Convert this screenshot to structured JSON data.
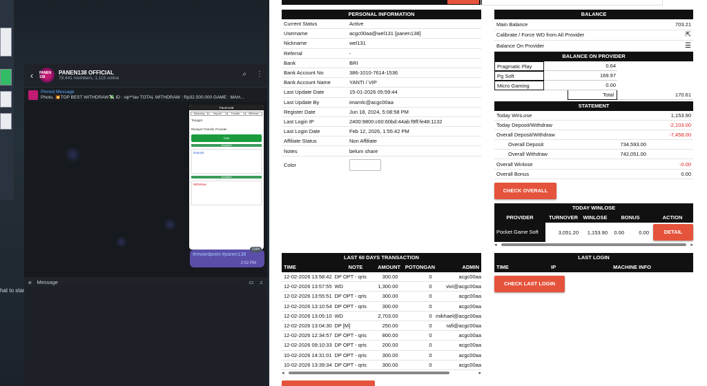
{
  "telegram": {
    "channel_name": "PANEN138 OFFICIAL",
    "channel_sub": "78,441 members, 1,115 online",
    "avatar_text": "PANEN 138",
    "pinned_label": "Pinned Message",
    "pinned_text": "Photo, 💥TOP BEST WITHDRAW💸 ID : vip**iav TOTAL WITHDRAW : Rp32.500.000 GAME : MAH...",
    "reward_text": "#rewardpoint #panen138",
    "reward_time": "2:02 PM",
    "reward_badge": "2184",
    "input_placeholder": "Message",
    "side_text": "hat to start messaging",
    "phone": {
      "logo": "Panen138",
      "tabs": [
        "Balancing",
        "Deposit",
        "Transfer",
        "Withdraw"
      ],
      "label_date": "Tanggal",
      "label_provider": "Riwayat Transfer Provider",
      "btn": "Cari",
      "accepted": "Accepted",
      "deposit": "Deposit",
      "withdraw": "Withdraw"
    }
  },
  "personal": {
    "title": "PERSONAL INFORMATION",
    "rows": [
      {
        "k": "Current Status",
        "v": "Active"
      },
      {
        "k": "Username",
        "v": "acgc00aa@wel131  [panen138]"
      },
      {
        "k": "Nickname",
        "v": "wel131"
      },
      {
        "k": "Referral",
        "v": "-"
      },
      {
        "k": "Bank",
        "v": "BRI"
      },
      {
        "k": "Bank Account No",
        "v": "386-1010-7614-1536"
      },
      {
        "k": "Bank Account Name",
        "v": "YANTI / VIP"
      },
      {
        "k": "Last Update Date",
        "v": "15-01-2026 05:59:44"
      },
      {
        "k": "Last Update By",
        "v": "imamlc@acgc00aa"
      },
      {
        "k": "Register Date",
        "v": "Jun 18, 2024, 5:08:58 PM"
      },
      {
        "k": "Last Login IP",
        "v": "2400:9800:c60:60bd:44ab:f9ff:fe48:1132"
      },
      {
        "k": "Last Login Date",
        "v": "Feb 12, 2026, 1:55:42 PM"
      },
      {
        "k": "Affiliate Status",
        "v": "Non Affiliate"
      },
      {
        "k": "Notes",
        "v": "belum share"
      }
    ],
    "color_label": "Color"
  },
  "balance": {
    "title": "BALANCE",
    "main_label": "Main Balance",
    "main_value": "703.21",
    "calibrate_label": "Calibrate / Force WD from All Provider",
    "onprovider_label": "Balance On Provider",
    "provider_title": "BALANCE ON PROVIDER",
    "providers": [
      {
        "name": "Pragmatic Play",
        "value": "0.64"
      },
      {
        "name": "Pg Soft",
        "value": "169.97"
      },
      {
        "name": "Micro Gaming",
        "value": "0.00"
      }
    ],
    "total_label": "Total",
    "total_value": "170.61"
  },
  "statement": {
    "title": "STATEMENT",
    "today_winlose_label": "Today WinLose",
    "today_winlose": "1,153.90",
    "today_dw_label": "Today Deposit/Withdraw",
    "today_dw": "-2,103.00",
    "overall_dw_label": "Overall Deposit/Withdraw",
    "overall_dw": "-7,458.00",
    "overall_deposit_label": "Overall Deposit",
    "overall_deposit": "734,593.00",
    "overall_withdraw_label": "Overall Withdraw",
    "overall_withdraw": "742,051.00",
    "overall_winlose_label": "Overall Winlose",
    "overall_winlose": "-0.00",
    "overall_bonus_label": "Overall Bonus",
    "overall_bonus": "0.00",
    "check_overall": "CHECK OVERALL"
  },
  "today_winlose": {
    "title": "TODAY WINLOSE",
    "cols": [
      "PROVIDER",
      "TURNOVER",
      "WINLOSE",
      "BONUS",
      "ACTION"
    ],
    "row": {
      "provider": "Pocket Game Soft",
      "turnover": "3,051.20",
      "winlose": "1,153.90",
      "bonus1": "0.00",
      "bonus2": "0.00",
      "action": "DETAIL"
    }
  },
  "last_login": {
    "title": "LAST LOGIN",
    "cols": [
      "TIME",
      "IP",
      "MACHINE INFO"
    ],
    "button": "CHECK LAST LOGIN"
  },
  "last60": {
    "title": "LAST 60 DAYS TRANSACTION",
    "cols": [
      "TIME",
      "NOTE",
      "AMOUNT",
      "POTONGAN",
      "ADMIN"
    ],
    "rows": [
      [
        "12-02-2026 13:58:42",
        "DP OPT - qris",
        "300.00",
        "0",
        "acgc00aa"
      ],
      [
        "12-02-2026 13:57:55",
        "WD",
        "1,300.00",
        "0",
        "vivi@acgc00aa"
      ],
      [
        "12-02-2026 13:55:51",
        "DP OPT - qris",
        "300.00",
        "0",
        "acgc00aa"
      ],
      [
        "12-02-2026 13:10:54",
        "DP OPT - qris",
        "300.00",
        "0",
        "acgc00aa"
      ],
      [
        "12-02-2026 13:05:10",
        "WD",
        "2,703.00",
        "0",
        "mikhael@acgc00aa"
      ],
      [
        "12-02-2026 13:04:30",
        "DP [M]",
        "250.00",
        "0",
        "rafi@acgc00aa"
      ],
      [
        "12-02-2026 12:34:57",
        "DP OPT - qris",
        "800.00",
        "0",
        "acgc00aa"
      ],
      [
        "12-02-2026 09:10:33",
        "DP OPT - qris",
        "200.00",
        "0",
        "acgc00aa"
      ],
      [
        "10-02-2026 14:31:01",
        "DP OPT - qris",
        "300.00",
        "0",
        "acgc00aa"
      ],
      [
        "10-02-2026 13:39:34",
        "DP OPT - qris",
        "300.00",
        "0",
        "acgc00aa"
      ]
    ]
  }
}
